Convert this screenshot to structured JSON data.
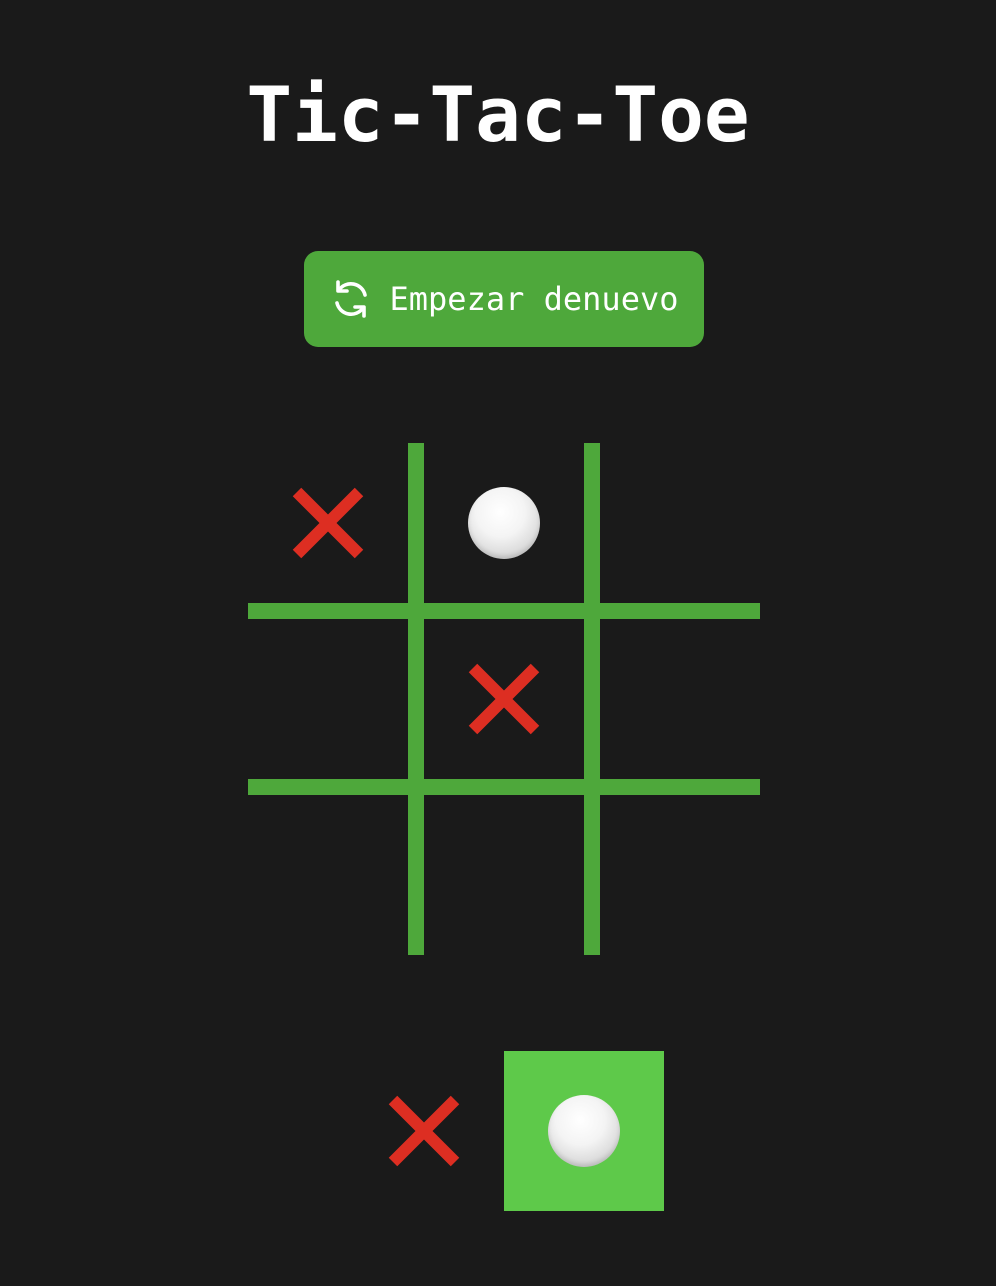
{
  "title": "Tic-Tac-Toe",
  "restart_button": {
    "label": "Empezar denuevo",
    "icon": "refresh-icon"
  },
  "colors": {
    "background": "#1a1a1a",
    "accent": "#4ea83b",
    "active_turn": "#5ec94a",
    "x_mark": "#dd2e22",
    "o_mark": "#eeeeee"
  },
  "board": [
    [
      "X",
      "O",
      ""
    ],
    [
      "",
      "X",
      ""
    ],
    [
      "",
      "",
      ""
    ]
  ],
  "turn_indicator": {
    "players": [
      "X",
      "O"
    ],
    "current": "O"
  }
}
